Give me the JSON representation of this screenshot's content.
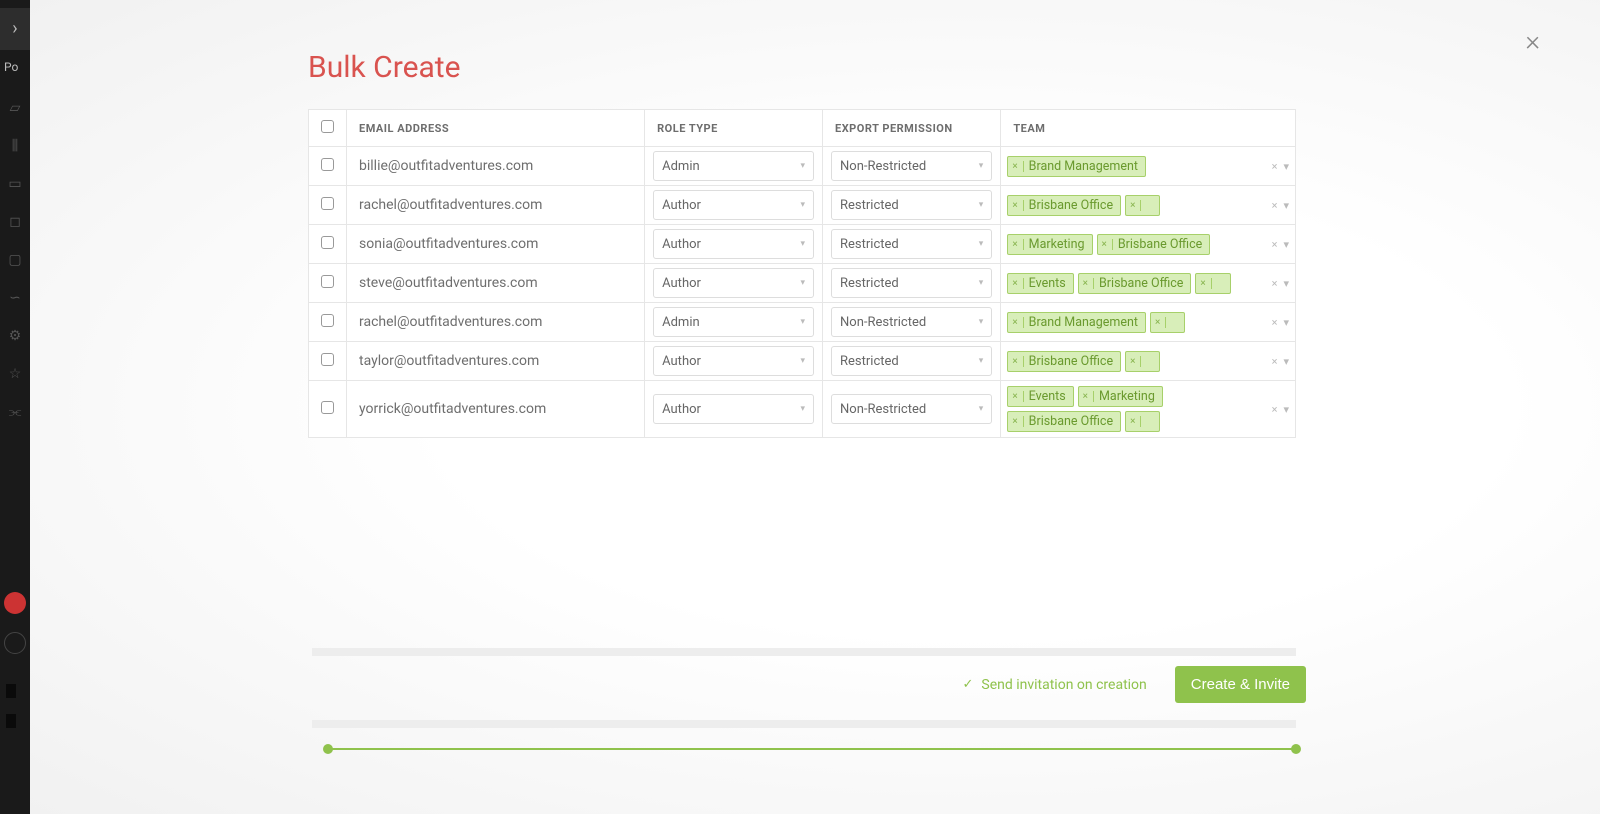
{
  "sidebar": {
    "po_text": "Po",
    "icons": [
      "folder-icon",
      "chart-icon",
      "clipboard-icon",
      "square-icon",
      "monitor-icon",
      "cloud-icon",
      "gear-icon",
      "star-icon",
      "share-icon"
    ]
  },
  "modal": {
    "title": "Bulk Create",
    "columns": {
      "email": "Email Address",
      "role": "Role Type",
      "export": "Export Permission",
      "team": "Team"
    },
    "rows": [
      {
        "email": "billie@outfitadventures.com",
        "role": "Admin",
        "export": "Non-Restricted",
        "teams": [
          "Brand Management"
        ]
      },
      {
        "email": "rachel@outfitadventures.com",
        "role": "Author",
        "export": "Restricted",
        "teams": [
          "Brisbane Office",
          ""
        ]
      },
      {
        "email": "sonia@outfitadventures.com",
        "role": "Author",
        "export": "Restricted",
        "teams": [
          "Marketing",
          "Brisbane Office"
        ]
      },
      {
        "email": "steve@outfitadventures.com",
        "role": "Author",
        "export": "Restricted",
        "teams": [
          "Events",
          "Brisbane Office",
          ""
        ]
      },
      {
        "email": "rachel@outfitadventures.com",
        "role": "Admin",
        "export": "Non-Restricted",
        "teams": [
          "Brand Management",
          ""
        ]
      },
      {
        "email": "taylor@outfitadventures.com",
        "role": "Author",
        "export": "Restricted",
        "teams": [
          "Brisbane Office",
          ""
        ]
      },
      {
        "email": "yorrick@outfitadventures.com",
        "role": "Author",
        "export": "Non-Restricted",
        "teams": [
          "Events",
          "Marketing",
          "Brisbane Office",
          ""
        ]
      }
    ],
    "footer": {
      "send_invite_label": "Send invitation on creation",
      "create_button": "Create & Invite"
    }
  }
}
